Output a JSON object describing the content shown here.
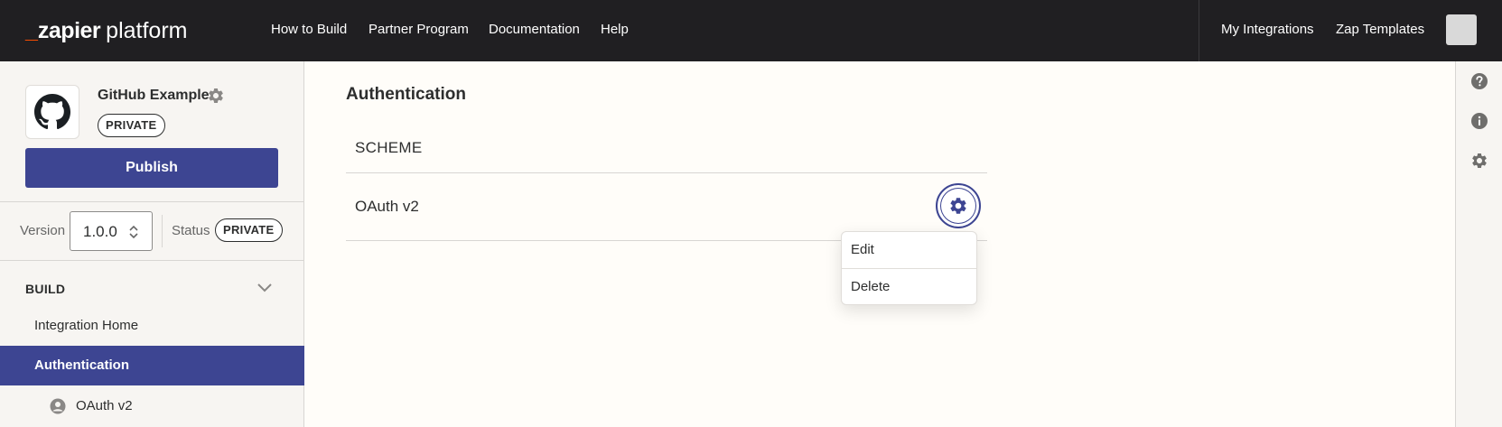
{
  "topbar": {
    "logo": {
      "brand": "zapier",
      "product": "platform"
    },
    "nav": [
      "How to Build",
      "Partner Program",
      "Documentation",
      "Help"
    ],
    "right_nav": [
      "My Integrations",
      "Zap Templates"
    ]
  },
  "sidebar": {
    "app_name": "GitHub Example",
    "app_badge": "PRIVATE",
    "publish_label": "Publish",
    "version_label": "Version",
    "version_value": "1.0.0",
    "status_label": "Status",
    "status_value": "PRIVATE",
    "section_label": "BUILD",
    "items": [
      {
        "label": "Integration Home",
        "active": false
      },
      {
        "label": "Authentication",
        "active": true
      }
    ],
    "sub_item": "OAuth v2"
  },
  "main": {
    "title": "Authentication",
    "column_header": "SCHEME",
    "rows": [
      {
        "label": "OAuth v2"
      }
    ],
    "menu": [
      "Edit",
      "Delete"
    ]
  },
  "colors": {
    "topbar": "#201f22",
    "accent": "#3d4592",
    "brand_orange": "#ff4f00",
    "sidebar_bg": "#f7f5f2",
    "page_bg": "#fffdf9"
  },
  "icons": {
    "rail": [
      "help-icon",
      "info-icon",
      "settings-gear-icon"
    ]
  }
}
